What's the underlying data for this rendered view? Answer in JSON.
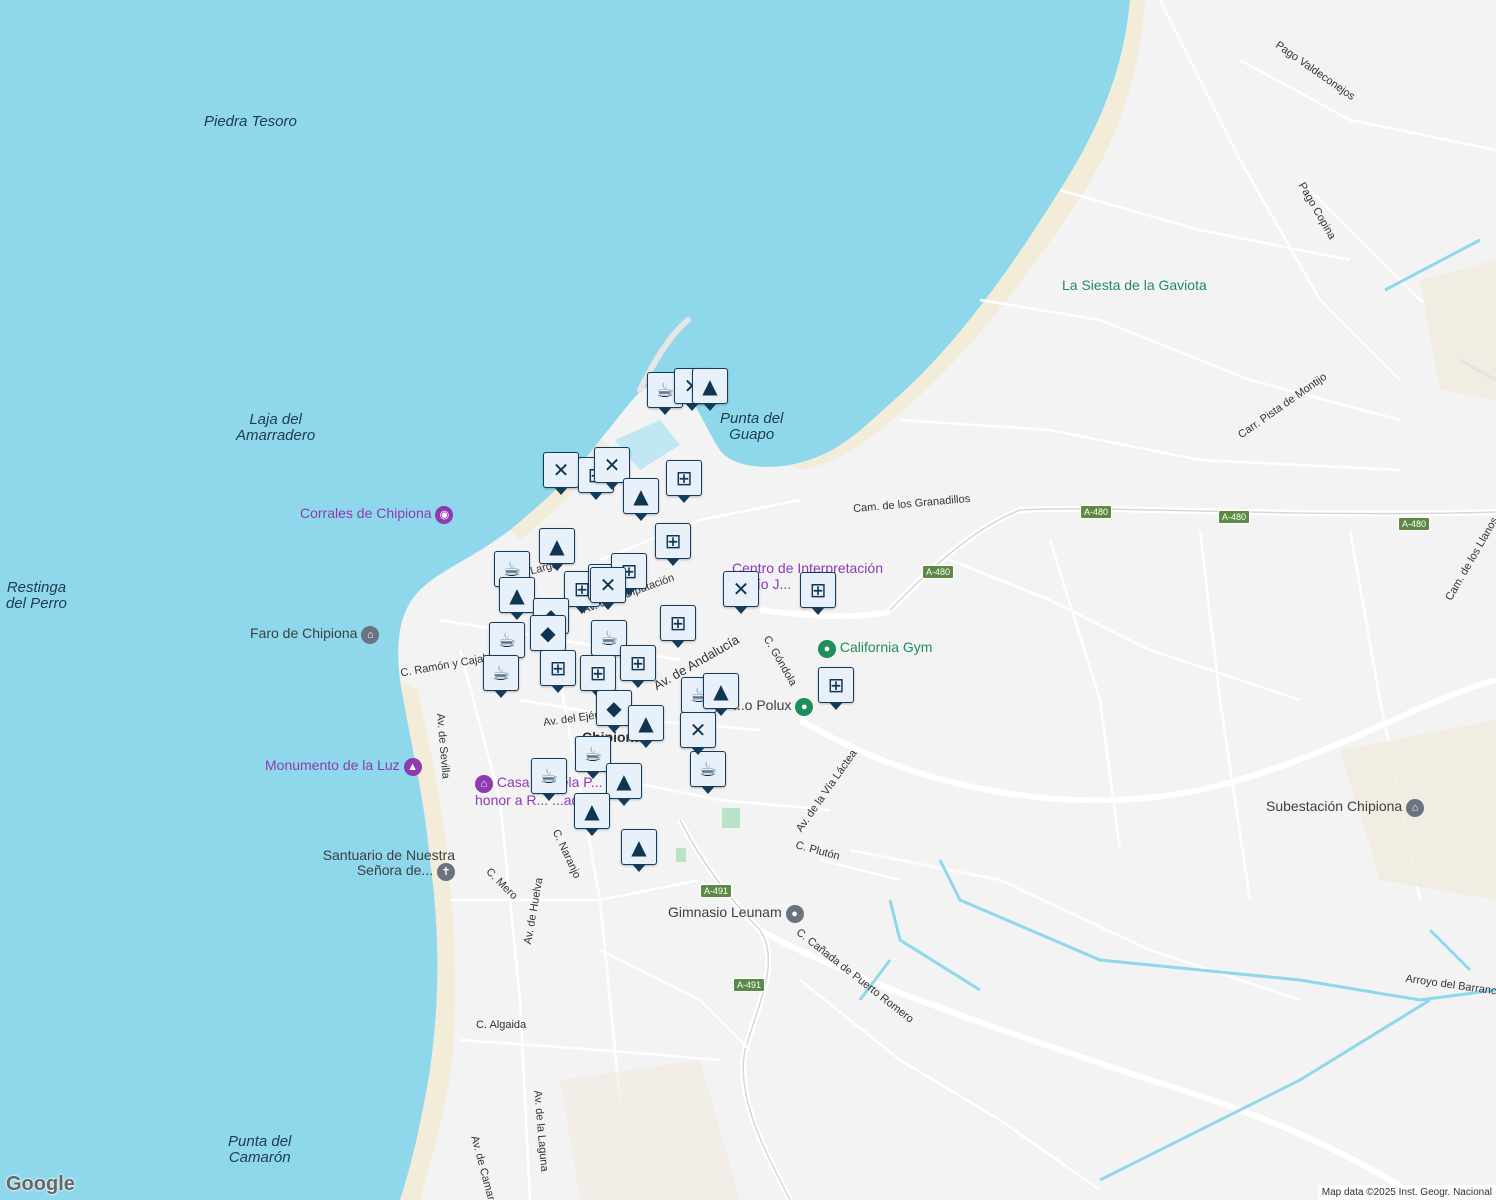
{
  "map": {
    "water_labels": [
      "Piedra Tesoro",
      "Laja del\nAmarradero",
      "Restinga\ndel Perro",
      "Punta del\nGuapo",
      "Punta del\nCamarón"
    ],
    "streets": [
      "Pago Valdeconejos",
      "Pago Copina",
      "Carr. Pista de Montijo",
      "Cam. de los Granadillos",
      "Cam. de los Llanos",
      "Av. de la Diputación",
      "Av. de Andalucía",
      "C. Góndola",
      "C. Ramón y Cajal",
      "Av. del Ejército",
      "Av. de Sevilla",
      "Av. de la Vía Láctea",
      "C. Plutón",
      "C. Naranjo",
      "C. Mero",
      "Av. de Huelva",
      "C. Cañada de Puerto Romero",
      "C. Algaida",
      "Av. de la Laguna",
      "Av. de Camarón",
      "Arroyo del Barrancón",
      "Larga"
    ],
    "pois": {
      "corrales": "Corrales de Chipiona",
      "faro": "Faro de Chipiona",
      "centro": "Centro de Interpretación Rocío J...",
      "california": "California Gym",
      "polux": "...o Polux",
      "monumento": "Monumento de la Luz",
      "casa": "Casa ...buela P... en honor a R... ...ado",
      "santuario": "Santuario de Nuestra Señora de...",
      "gimnasio": "Gimnasio Leunam",
      "subestacion": "Subestación Chipiona",
      "siesta": "La Siesta de la Gaviota"
    },
    "town": "Chipiona",
    "shields": [
      "A-480",
      "A-480",
      "A-480",
      "A-480",
      "A-491",
      "A-491"
    ],
    "pins": [
      "coffee-icon",
      "restaurant-icon",
      "education-icon",
      "restaurant-icon",
      "shopping-cart-icon",
      "restaurant-icon",
      "shopping-cart-icon",
      "education-icon",
      "shopping-cart-icon",
      "education-icon",
      "coffee-icon",
      "education-icon",
      "shopping-cart-icon",
      "restaurant-icon",
      "shopping-cart-icon",
      "restaurant-icon",
      "shopping-bag-icon",
      "shopping-bag-icon",
      "coffee-icon",
      "coffee-icon",
      "shopping-cart-icon",
      "shopping-cart-icon",
      "coffee-icon",
      "shopping-bag-icon",
      "shopping-cart-icon",
      "shopping-cart-icon",
      "coffee-icon",
      "education-icon",
      "restaurant-icon",
      "coffee-icon",
      "education-icon",
      "coffee-icon",
      "coffee-icon",
      "education-icon",
      "education-icon",
      "education-icon",
      "restaurant-icon",
      "shopping-cart-icon",
      "shopping-cart-icon"
    ]
  },
  "footer": {
    "logo": "Google",
    "attribution": "Map data ©2025 Inst. Geogr. Nacional"
  },
  "colors": {
    "sea": "#8fd8ec",
    "land": "#f3f3f4",
    "beach": "#f3ecd9",
    "pin_bg": "#e8f0fa",
    "pin_border": "#123b5c",
    "poi_purple": "#8e3ab0",
    "poi_green": "#1e8e5a",
    "road_shield": "#5c8a44"
  }
}
